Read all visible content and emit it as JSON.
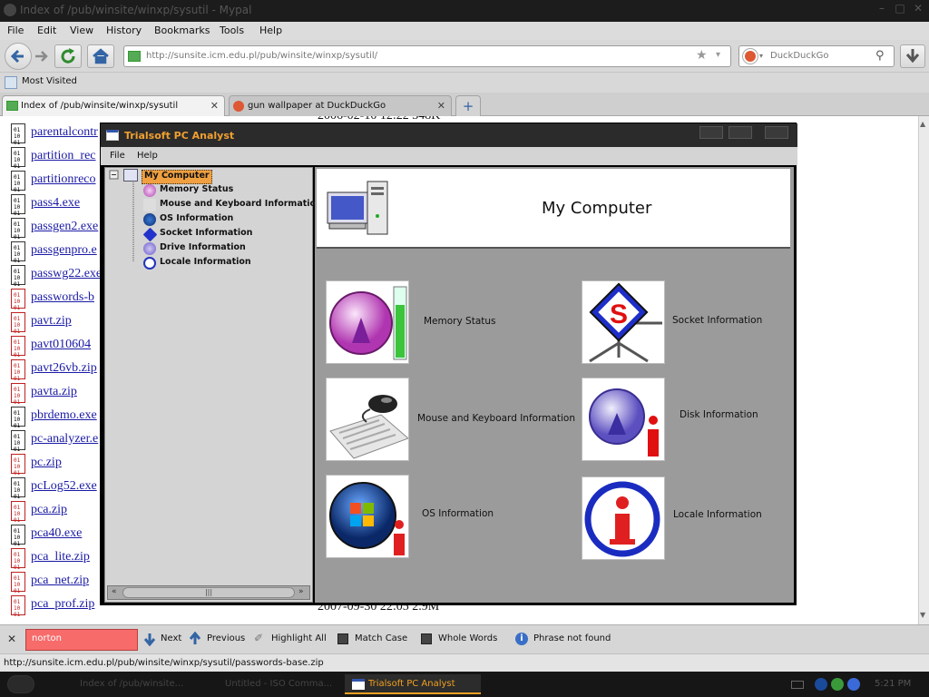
{
  "browser": {
    "window_title": "Index of /pub/winsite/winxp/sysutil - Mypal",
    "menu": [
      "File",
      "Edit",
      "View",
      "History",
      "Bookmarks",
      "Tools",
      "Help"
    ],
    "url": "http://sunsite.icm.edu.pl/pub/winsite/winxp/sysutil/",
    "search_engine": "DuckDuckGo",
    "bookmarks_label": "Most Visited",
    "tabs": [
      {
        "title": "Index of /pub/winsite/winxp/sysutil",
        "active": true
      },
      {
        "title": "gun wallpaper at DuckDuckGo",
        "active": false
      }
    ],
    "new_tab_glyph": "+"
  },
  "listing": {
    "files": [
      {
        "name": "parentalcontr",
        "kind": "exe"
      },
      {
        "name": "partition_rec",
        "kind": "exe"
      },
      {
        "name": "partitionreco",
        "kind": "exe"
      },
      {
        "name": "pass4.exe",
        "kind": "exe"
      },
      {
        "name": "passgen2.exe",
        "kind": "exe"
      },
      {
        "name": "passgenpro.e",
        "kind": "exe"
      },
      {
        "name": "passwg22.exe",
        "kind": "exe"
      },
      {
        "name": "passwords-b",
        "kind": "zip"
      },
      {
        "name": "pavt.zip",
        "kind": "zip"
      },
      {
        "name": "pavt010604",
        "kind": "zip"
      },
      {
        "name": "pavt26vb.zip",
        "kind": "zip"
      },
      {
        "name": "pavta.zip",
        "kind": "zip"
      },
      {
        "name": "pbrdemo.exe",
        "kind": "exe"
      },
      {
        "name": "pc-analyzer.e",
        "kind": "exe"
      },
      {
        "name": "pc.zip",
        "kind": "zip"
      },
      {
        "name": "pcLog52.exe",
        "kind": "exe"
      },
      {
        "name": "pca.zip",
        "kind": "zip"
      },
      {
        "name": "pca40.exe",
        "kind": "exe"
      },
      {
        "name": "pca_lite.zip",
        "kind": "zip"
      },
      {
        "name": "pca_net.zip",
        "kind": "zip"
      },
      {
        "name": "pca_prof.zip",
        "kind": "zip"
      }
    ],
    "top_partial": "2006-02-10 12:22  348K",
    "bottom_partial": "2007-09-30 22:05  2.9M"
  },
  "findbar": {
    "query": "norton",
    "next": "Next",
    "previous": "Previous",
    "highlight_all": "Highlight All",
    "match_case": "Match Case",
    "whole_words": "Whole Words",
    "status": "Phrase not found"
  },
  "statusbar": {
    "link": "http://sunsite.icm.edu.pl/pub/winsite/winxp/sysutil/passwords-base.zip"
  },
  "taskbar": {
    "items": [
      {
        "label": "Index of /pub/winsite...",
        "active": false
      },
      {
        "label": "Untitled - ISO Comma...",
        "active": false
      },
      {
        "label": "Trialsoft PC Analyst",
        "active": true
      }
    ],
    "clock": "5:21 PM"
  },
  "app": {
    "title": "Trialsoft PC Analyst",
    "menu": [
      "File",
      "Help"
    ],
    "tree": {
      "root": "My Computer",
      "children": [
        "Memory Status",
        "Mouse and Keyboard Information",
        "OS Information",
        "Socket Information",
        "Drive Information",
        "Locale Information"
      ]
    },
    "header_title": "My Computer",
    "tiles": [
      {
        "label": "Memory Status",
        "icon": "memory-gauge-icon"
      },
      {
        "label": "Socket Information",
        "icon": "socket-icon"
      },
      {
        "label": "Mouse and Keyboard Information",
        "icon": "mouse-keyboard-icon"
      },
      {
        "label": "Disk Information",
        "icon": "disk-info-icon"
      },
      {
        "label": "OS Information",
        "icon": "windows-logo-icon"
      },
      {
        "label": "Locale Information",
        "icon": "locale-info-icon"
      }
    ],
    "hscroll_grip": "|||",
    "colors": {
      "title_accent": "#f0a030",
      "panel_bg": "#9b9b9b",
      "selection": "#f0a040"
    }
  }
}
